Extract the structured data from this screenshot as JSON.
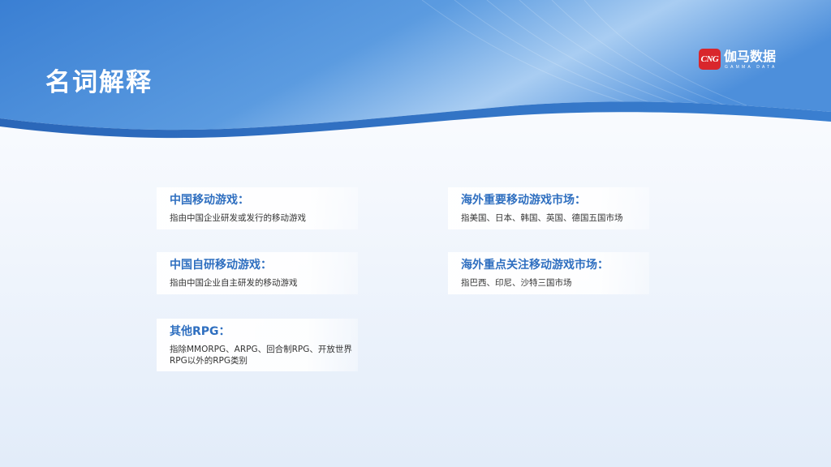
{
  "header": {
    "title": "名词解释"
  },
  "logo": {
    "mark_text": "CNG",
    "name": "伽马数据",
    "sub": "GAMMA DATA"
  },
  "terms": [
    {
      "title": "中国移动游戏：",
      "description": "指由中国企业研发或发行的移动游戏"
    },
    {
      "title": "中国自研移动游戏：",
      "description": "指由中国企业自主研发的移动游戏"
    },
    {
      "title": "其他RPG：",
      "description": "指除MMORPG、ARPG、回合制RPG、开放世界RPG以外的RPG类别"
    },
    {
      "title": "海外重要移动游戏市场：",
      "description": "指美国、日本、韩国、英国、德国五国市场"
    },
    {
      "title": "海外重点关注移动游戏市场：",
      "description": "指巴西、印尼、沙特三国市场"
    }
  ],
  "colors": {
    "header_blue": "#3f86d6",
    "accent_blue": "#2f6fc0",
    "logo_red": "#d9262c"
  }
}
